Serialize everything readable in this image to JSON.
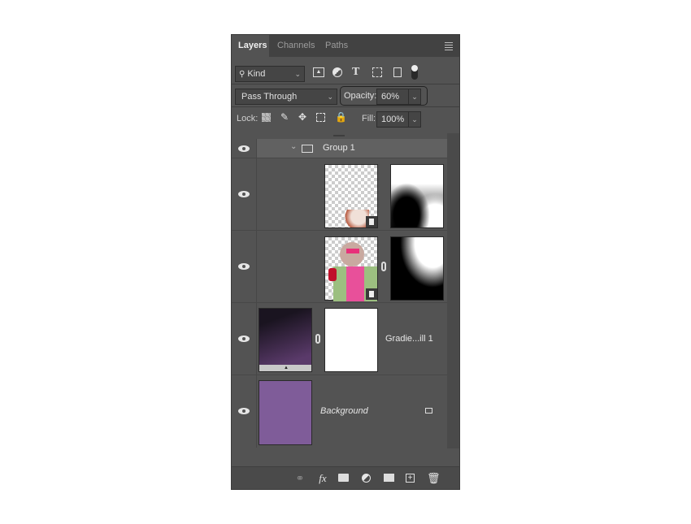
{
  "tabs": [
    {
      "label": "Layers",
      "active": true
    },
    {
      "label": "Channels",
      "active": false
    },
    {
      "label": "Paths",
      "active": false
    }
  ],
  "filter": {
    "kind_label": "Kind",
    "filter_icons": [
      "image-filter-icon",
      "adjustment-filter-icon",
      "type-filter-icon",
      "shape-filter-icon",
      "smart-object-filter-icon",
      "filter-toggle"
    ]
  },
  "blend": {
    "mode": "Pass Through",
    "opacity_label": "Opacity:",
    "opacity_value": "60%"
  },
  "lock": {
    "label": "Lock:",
    "fill_label": "Fill:",
    "fill_value": "100%"
  },
  "layers": [
    {
      "name": "Group 1",
      "type": "group",
      "visible": true
    },
    {
      "name": "",
      "type": "smart-object-masked",
      "visible": true
    },
    {
      "name": "",
      "type": "smart-object-masked",
      "visible": true
    },
    {
      "name": "Gradie...ill 1",
      "type": "gradient-fill",
      "visible": true
    },
    {
      "name": "Background",
      "type": "background",
      "visible": true,
      "locked": true
    }
  ],
  "colors": {
    "background_layer": "#7f5c99",
    "panel": "#535353"
  },
  "footer_icons": [
    "link-layers-icon",
    "fx-icon",
    "add-mask-icon",
    "adjustment-layer-icon",
    "new-group-icon",
    "new-layer-icon",
    "delete-icon"
  ],
  "footer": {
    "fx_label": "fx"
  }
}
